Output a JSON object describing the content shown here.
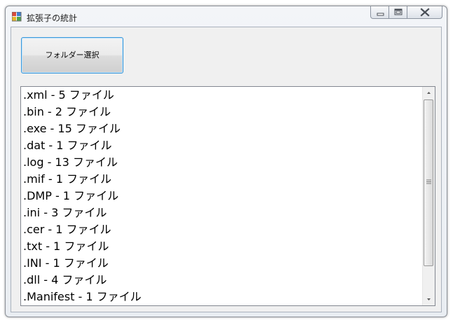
{
  "window": {
    "title": "拡張子の統計"
  },
  "toolbar": {
    "folder_select_label": "フォルダー選択"
  },
  "list": {
    "items": [
      ".xml - 5 ファイル",
      ".bin - 2 ファイル",
      ".exe - 15 ファイル",
      ".dat - 1 ファイル",
      ".log - 13 ファイル",
      ".mif - 1 ファイル",
      ".DMP - 1 ファイル",
      ".ini - 3 ファイル",
      ".cer - 1 ファイル",
      ".txt - 1 ファイル",
      ".INI - 1 ファイル",
      ".dll - 4 ファイル",
      ".Manifest - 1 ファイル"
    ]
  },
  "icons": {
    "app": "app-icon",
    "minimize": "minimize-icon",
    "maximize": "maximize-icon",
    "close": "close-icon",
    "scroll_up": "chevron-up-icon",
    "scroll_down": "chevron-down-icon",
    "thumb_grip": "grip-icon"
  },
  "colors": {
    "button_focus_border": "#3c98d9",
    "window_background": "#f0f0f0",
    "list_background": "#ffffff"
  }
}
